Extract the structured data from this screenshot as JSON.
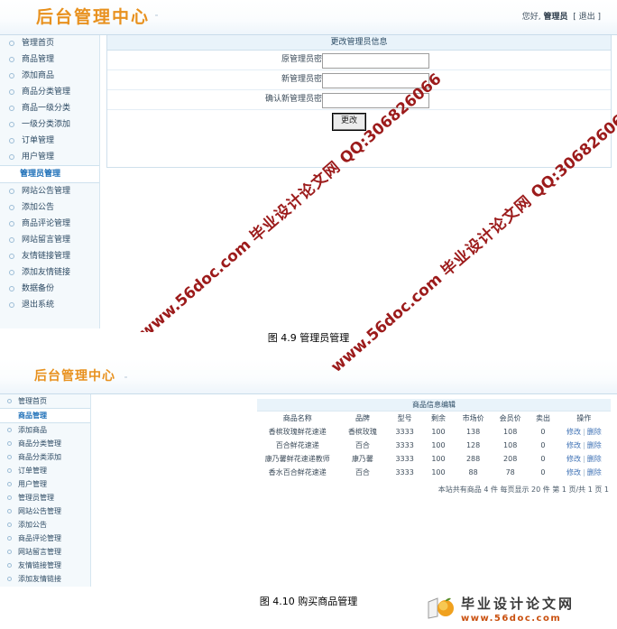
{
  "figure1": {
    "header": {
      "title": "后台管理中心",
      "greeting": "您好,",
      "user": "管理员",
      "logout": "[ 退出 ]"
    },
    "sidebar": {
      "items": [
        {
          "label": "管理首页",
          "active": false
        },
        {
          "label": "商品管理",
          "active": false
        },
        {
          "label": "添加商品",
          "active": false
        },
        {
          "label": "商品分类管理",
          "active": false
        },
        {
          "label": "商品一级分类",
          "active": false
        },
        {
          "label": "一级分类添加",
          "active": false
        },
        {
          "label": "订单管理",
          "active": false
        },
        {
          "label": "用户管理",
          "active": false
        },
        {
          "label": "管理员管理",
          "active": true
        },
        {
          "label": "网站公告管理",
          "active": false
        },
        {
          "label": "添加公告",
          "active": false
        },
        {
          "label": "商品评论管理",
          "active": false
        },
        {
          "label": "网站留言管理",
          "active": false
        },
        {
          "label": "友情链接管理",
          "active": false
        },
        {
          "label": "添加友情链接",
          "active": false
        },
        {
          "label": "数据备份",
          "active": false
        },
        {
          "label": "退出系统",
          "active": false
        }
      ]
    },
    "form": {
      "panel_title": "更改管理员信息",
      "fields": [
        {
          "label": "原管理员密码:",
          "value": ""
        },
        {
          "label": "新管理员密码:",
          "value": ""
        },
        {
          "label": "确认新管理员密码:",
          "value": ""
        }
      ],
      "submit_label": "更改"
    },
    "caption": "图 4.9  管理员管理"
  },
  "figure2": {
    "header": {
      "title": "后台管理中心"
    },
    "sidebar": {
      "items": [
        {
          "label": "管理首页",
          "active": false
        },
        {
          "label": "商品管理",
          "active": true
        },
        {
          "label": "添加商品",
          "active": false
        },
        {
          "label": "商品分类管理",
          "active": false
        },
        {
          "label": "商品分类添加",
          "active": false
        },
        {
          "label": "订单管理",
          "active": false
        },
        {
          "label": "用户管理",
          "active": false
        },
        {
          "label": "管理员管理",
          "active": false
        },
        {
          "label": "网站公告管理",
          "active": false
        },
        {
          "label": "添加公告",
          "active": false
        },
        {
          "label": "商品评论管理",
          "active": false
        },
        {
          "label": "网站留言管理",
          "active": false
        },
        {
          "label": "友情链接管理",
          "active": false
        },
        {
          "label": "添加友情链接",
          "active": false
        }
      ]
    },
    "table": {
      "title": "商品信息编辑",
      "columns": [
        "商品名称",
        "品牌",
        "型号",
        "剩余",
        "市场价",
        "会员价",
        "卖出",
        "操作"
      ],
      "rows": [
        {
          "name": "香槟玫瑰鲜花速递",
          "brand": "香槟玫瑰",
          "model": "3333",
          "stock": "100",
          "market_price": "138",
          "member_price": "108",
          "sold": "0"
        },
        {
          "name": "百合鲜花速递",
          "brand": "百合",
          "model": "3333",
          "stock": "100",
          "market_price": "128",
          "member_price": "108",
          "sold": "0"
        },
        {
          "name": "康乃馨鲜花速递教师",
          "brand": "康乃馨",
          "model": "3333",
          "stock": "100",
          "market_price": "288",
          "member_price": "208",
          "sold": "0"
        },
        {
          "name": "香水百合鲜花速递",
          "brand": "百合",
          "model": "3333",
          "stock": "100",
          "market_price": "88",
          "member_price": "78",
          "sold": "0"
        }
      ],
      "action_edit": "修改",
      "action_sep": "|",
      "action_delete": "删除",
      "footer": "本站共有商品 4 件 每页显示 20 件 第 1 页/共 1 页 1"
    },
    "caption": "图 4.10  购买商品管理"
  },
  "watermarks": [
    {
      "url": "www.56doc.com",
      "cn": "毕业设计论文网",
      "qq": "QQ:306826066"
    },
    {
      "url": "www.56doc.com",
      "cn": "毕业设计论文网",
      "qq": "QQ:306826066"
    },
    {
      "url": "www.56doc.com",
      "cn": "毕业设计论文网",
      "qq": "QQ:306826066"
    }
  ],
  "site_logo": {
    "name": "毕业设计论文网",
    "url": "www.56doc.com"
  },
  "colors": {
    "brand_orange": "#e8911e",
    "panel_blue": "#e9f3fa",
    "link_blue": "#3f72b5",
    "active_blue": "#1d6fb8",
    "watermark_red": "#9c1b1b",
    "logo_orange": "#c9500f"
  }
}
